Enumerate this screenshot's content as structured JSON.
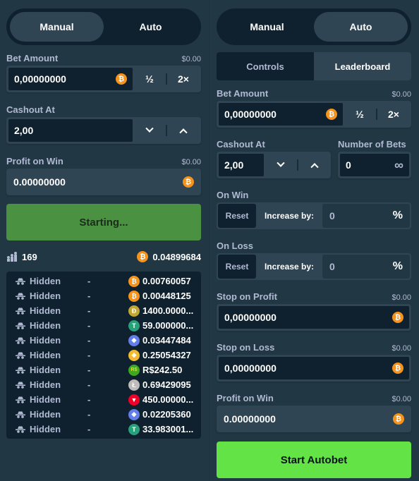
{
  "left": {
    "mode_tabs": [
      "Manual",
      "Auto"
    ],
    "active_mode": "Manual",
    "bet_amount": {
      "label": "Bet Amount",
      "usd": "$0.00",
      "value": "0,00000000",
      "half": "½",
      "double": "2×"
    },
    "cashout": {
      "label": "Cashout At",
      "value": "2,00"
    },
    "profit": {
      "label": "Profit on Win",
      "usd": "$0.00",
      "value": "0.00000000"
    },
    "action_button": "Starting...",
    "player_count": "169",
    "total_amount": "0.04899684",
    "players": [
      {
        "name": "Hidden",
        "multiplier": "-",
        "currency": "btc",
        "amount": "0.00760057"
      },
      {
        "name": "Hidden",
        "multiplier": "-",
        "currency": "btc",
        "amount": "0.00448125"
      },
      {
        "name": "Hidden",
        "multiplier": "-",
        "currency": "doge",
        "amount": "1400.0000..."
      },
      {
        "name": "Hidden",
        "multiplier": "-",
        "currency": "usdt",
        "amount": "59.000000..."
      },
      {
        "name": "Hidden",
        "multiplier": "-",
        "currency": "eth",
        "amount": "0.03447484"
      },
      {
        "name": "Hidden",
        "multiplier": "-",
        "currency": "bnb",
        "amount": "0.25054327"
      },
      {
        "name": "Hidden",
        "multiplier": "-",
        "currency": "brl",
        "amount": "R$242.50"
      },
      {
        "name": "Hidden",
        "multiplier": "-",
        "currency": "ltc",
        "amount": "0.69429095"
      },
      {
        "name": "Hidden",
        "multiplier": "-",
        "currency": "trx",
        "amount": "450.00000..."
      },
      {
        "name": "Hidden",
        "multiplier": "-",
        "currency": "eth",
        "amount": "0.02205360"
      },
      {
        "name": "Hidden",
        "multiplier": "-",
        "currency": "usdt",
        "amount": "33.983001..."
      }
    ]
  },
  "right": {
    "mode_tabs": [
      "Manual",
      "Auto"
    ],
    "active_mode": "Auto",
    "sub_tabs": [
      "Controls",
      "Leaderboard"
    ],
    "active_sub_tab": "Leaderboard",
    "bet_amount": {
      "label": "Bet Amount",
      "usd": "$0.00",
      "value": "0,00000000",
      "half": "½",
      "double": "2×"
    },
    "cashout": {
      "label": "Cashout At",
      "value": "2,00"
    },
    "num_bets": {
      "label": "Number of Bets",
      "value": "0"
    },
    "on_win": {
      "label": "On Win",
      "reset": "Reset",
      "increase_label": "Increase by:",
      "value": "0",
      "unit": "%"
    },
    "on_loss": {
      "label": "On Loss",
      "reset": "Reset",
      "increase_label": "Increase by:",
      "value": "0",
      "unit": "%"
    },
    "stop_profit": {
      "label": "Stop on Profit",
      "usd": "$0.00",
      "value": "0,00000000"
    },
    "stop_loss": {
      "label": "Stop on Loss",
      "usd": "$0.00",
      "value": "0,00000000"
    },
    "profit": {
      "label": "Profit on Win",
      "usd": "$0.00",
      "value": "0.00000000"
    },
    "action_button": "Start Autobet"
  },
  "currency_colors": {
    "btc": "#f7931a",
    "doge": "#c2a633",
    "usdt": "#26a17b",
    "eth": "#627eea",
    "bnb": "#f3ba2f",
    "brl": "#3ea81e",
    "ltc": "#bfbbbb",
    "trx": "#ef0027"
  },
  "currency_glyphs": {
    "btc": "₿",
    "doge": "Ð",
    "usdt": "T",
    "eth": "◆",
    "bnb": "◈",
    "brl": "R$",
    "ltc": "Ł",
    "trx": "▼"
  }
}
